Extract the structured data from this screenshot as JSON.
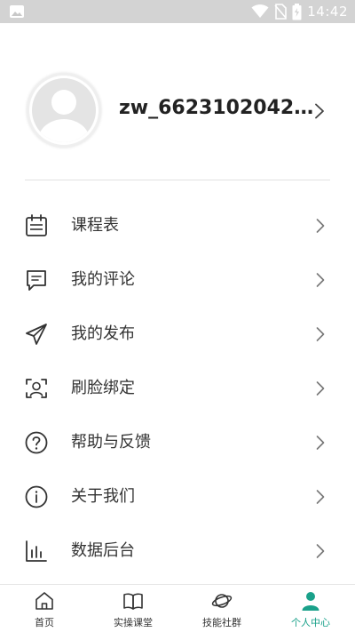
{
  "status_bar": {
    "time": "14:42"
  },
  "profile": {
    "username": "zw_662310204293..."
  },
  "menu": {
    "items": [
      {
        "label": "课程表",
        "icon": "calendar-icon"
      },
      {
        "label": "我的评论",
        "icon": "comment-icon"
      },
      {
        "label": "我的发布",
        "icon": "send-icon"
      },
      {
        "label": "刷脸绑定",
        "icon": "face-scan-icon"
      },
      {
        "label": "帮助与反馈",
        "icon": "help-icon"
      },
      {
        "label": "关于我们",
        "icon": "info-icon"
      },
      {
        "label": "数据后台",
        "icon": "bar-chart-icon"
      }
    ]
  },
  "bottom_nav": {
    "tabs": [
      {
        "label": "首页",
        "icon": "home-icon"
      },
      {
        "label": "实操课堂",
        "icon": "book-icon"
      },
      {
        "label": "技能社群",
        "icon": "planet-icon"
      },
      {
        "label": "个人中心",
        "icon": "person-icon",
        "active": true
      }
    ]
  },
  "colors": {
    "accent": "#1aa18a",
    "status_bar": "#d3d3d3"
  }
}
